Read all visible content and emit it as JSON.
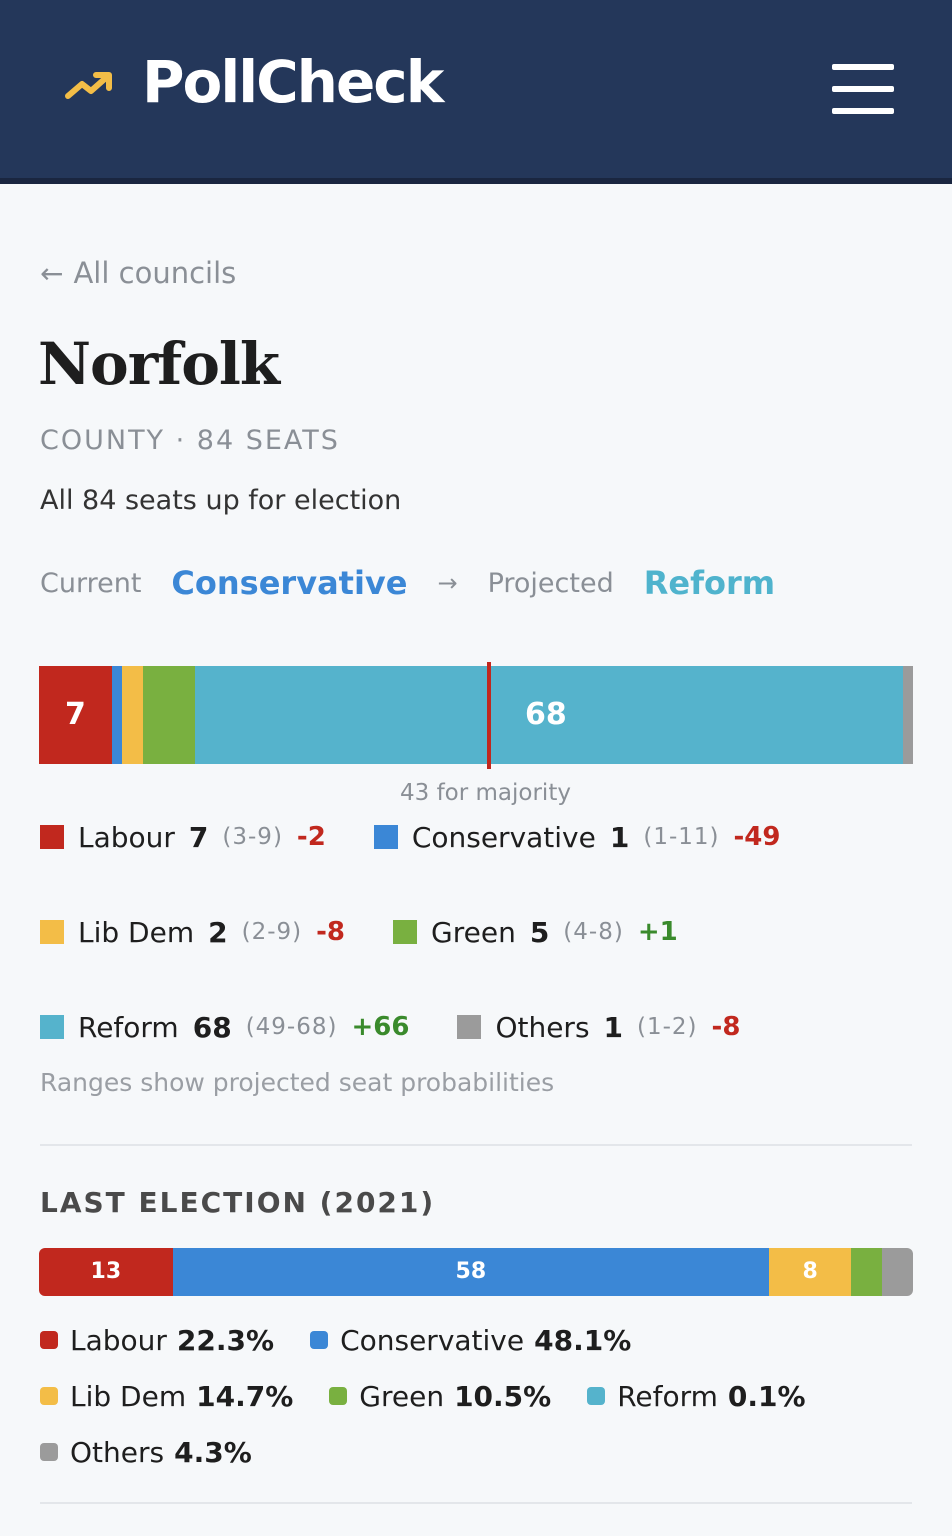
{
  "header": {
    "brand": "PollCheck",
    "logo_icon": "trending-up-icon",
    "menu_icon": "hamburger-menu-icon"
  },
  "back": {
    "label": "All councils",
    "icon": "arrow-left-icon"
  },
  "council": {
    "name": "Norfolk",
    "subtitle": "COUNTY · 84 SEATS",
    "description": "All 84 seats up for election",
    "current_label": "Current",
    "current_party": "Conservative",
    "projected_label": "Projected",
    "projected_party": "Reform",
    "arrow": "→"
  },
  "colors": {
    "labour": "#c1281e",
    "conservative": "#3b87d6",
    "libdem": "#f3bd47",
    "green": "#79b040",
    "reform": "#55b3cc",
    "others": "#9b9b9b"
  },
  "projection": {
    "total_seats": 84,
    "majority": 43,
    "majority_text": "43 for majority",
    "bar_labels": {
      "labour": "7",
      "reform": "68"
    },
    "parties": [
      {
        "key": "labour",
        "name": "Labour",
        "seats": "7",
        "range": "(3-9)",
        "change": "-2",
        "seat_value": 7
      },
      {
        "key": "conservative",
        "name": "Conservative",
        "seats": "1",
        "range": "(1-11)",
        "change": "-49",
        "seat_value": 1
      },
      {
        "key": "libdem",
        "name": "Lib Dem",
        "seats": "2",
        "range": "(2-9)",
        "change": "-8",
        "seat_value": 2
      },
      {
        "key": "green",
        "name": "Green",
        "seats": "5",
        "range": "(4-8)",
        "change": "+1",
        "seat_value": 5
      },
      {
        "key": "reform",
        "name": "Reform",
        "seats": "68",
        "range": "(49-68)",
        "change": "+66",
        "seat_value": 68
      },
      {
        "key": "others",
        "name": "Others",
        "seats": "1",
        "range": "(1-2)",
        "change": "-8",
        "seat_value": 1
      }
    ],
    "note": "Ranges show projected seat probabilities"
  },
  "last_election": {
    "heading": "LAST ELECTION (2021)",
    "bar_labels": {
      "labour": "13",
      "conservative": "58",
      "libdem": "8"
    },
    "seats": {
      "labour": 13,
      "conservative": 58,
      "libdem": 8,
      "green": 3,
      "others": 3
    },
    "shares": [
      {
        "key": "labour",
        "name": "Labour",
        "pct": "22.3%"
      },
      {
        "key": "conservative",
        "name": "Conservative",
        "pct": "48.1%"
      },
      {
        "key": "libdem",
        "name": "Lib Dem",
        "pct": "14.7%"
      },
      {
        "key": "green",
        "name": "Green",
        "pct": "10.5%"
      },
      {
        "key": "reform",
        "name": "Reform",
        "pct": "0.1%"
      },
      {
        "key": "others",
        "name": "Others",
        "pct": "4.3%"
      }
    ]
  }
}
